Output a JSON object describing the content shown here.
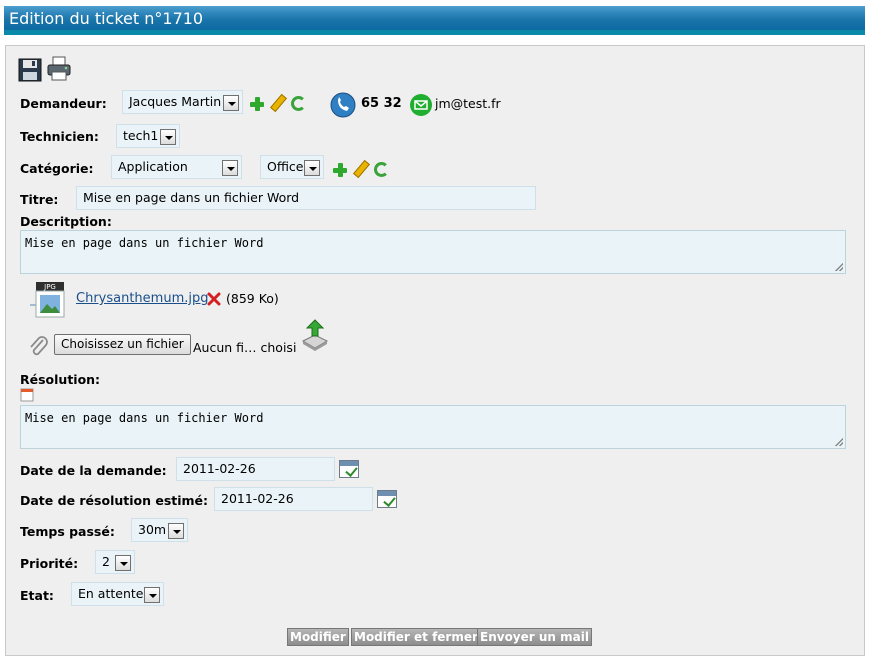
{
  "page": {
    "title": "Edition du ticket n°1710"
  },
  "toolbar": {
    "icons": [
      "save-icon",
      "print-icon"
    ]
  },
  "demandeur": {
    "label": "Demandeur:",
    "value": "Jacques Martin",
    "phone": "65 32",
    "email": "jm@test.fr"
  },
  "technicien": {
    "label": "Technicien:",
    "value": "tech1"
  },
  "categorie": {
    "label": "Catégorie:",
    "value": "Application",
    "subvalue": "Office"
  },
  "titre": {
    "label": "Titre:",
    "value": "Mise en page dans un fichier Word"
  },
  "description": {
    "label": "Descritption:",
    "value": "Mise en page dans un fichier Word"
  },
  "attachment": {
    "badge": "JPG",
    "filename": "Chrysanthemum.jpg",
    "size": "(859 Ko)"
  },
  "upload": {
    "button_label": "Choisissez un fichier",
    "status": "Aucun fi… choisi"
  },
  "resolution": {
    "label": "Résolution:",
    "value": "Mise en page dans un fichier Word"
  },
  "date_demande": {
    "label": "Date de la demande:",
    "value": "2011-02-26"
  },
  "date_resolution": {
    "label": "Date de résolution estimé:",
    "value": "2011-02-26"
  },
  "temps": {
    "label": "Temps passé:",
    "value": "30m"
  },
  "priorite": {
    "label": "Priorité:",
    "value": "2"
  },
  "etat": {
    "label": "Etat:",
    "value": "En attente"
  },
  "actions": {
    "modify": "Modifier",
    "modify_close": "Modifier et fermer",
    "send_mail": "Envoyer un mail"
  },
  "colors": {
    "header": "#1873a8",
    "header_border": "#0a89a9",
    "panel": "#efefef",
    "field": "#eaf4f8"
  }
}
